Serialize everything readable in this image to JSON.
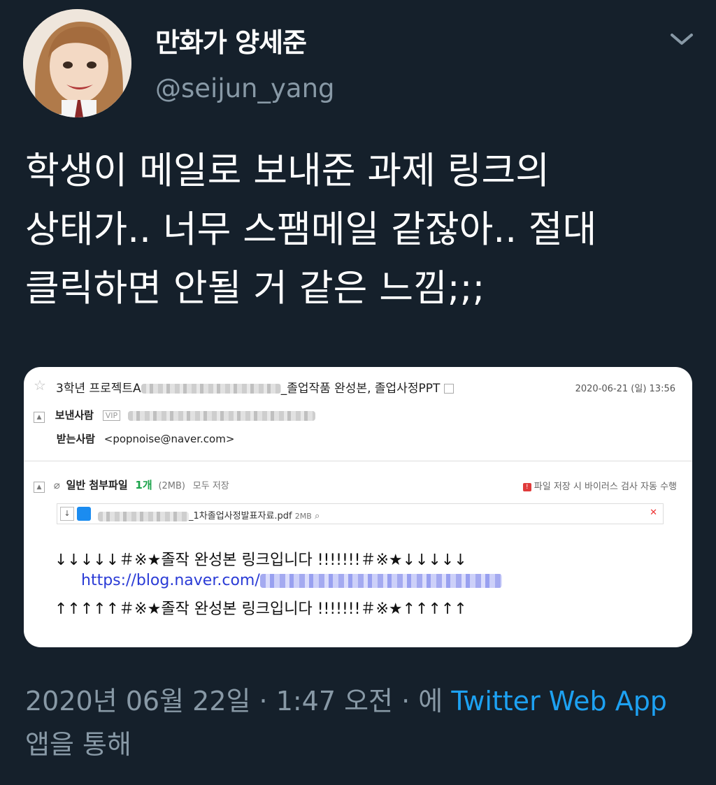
{
  "user": {
    "display_name": "만화가 양세준",
    "handle": "@seijun_yang"
  },
  "tweet": {
    "lines": [
      "학생이 메일로 보내준 과제 링크의",
      "상태가.. 너무 스팸메일 같잖아.. 절대",
      "클릭하면 안될 거 같은 느낌;;;"
    ]
  },
  "media": {
    "subject_prefix": "3학년 프로젝트A",
    "subject_suffix": "_졸업작품 완성본, 졸업사정PPT",
    "date": "2020-06-21 (일) 13:56",
    "sender_label": "보낸사람",
    "vip_badge": "VIP",
    "recipient_label": "받는사람",
    "recipient_value": "<popnoise@naver.com>",
    "attachment_label": "일반 첨부파일",
    "attachment_count": "1개",
    "attachment_size": "(2MB)",
    "save_all": "모두 저장",
    "virus_notice": "파일 저장 시 바이러스 검사 자동 수행",
    "file_name_suffix": "_1차졸업사정발표자료.pdf",
    "file_size": "2MB",
    "body_line_1": "↓↓↓↓↓＃※★졸작 완성본 링크입니다 !!!!!!!＃※★↓↓↓↓↓",
    "body_link_prefix": "https://blog.naver.com/",
    "body_line_2": "↑↑↑↑↑＃※★졸작 완성본 링크입니다 !!!!!!!＃※★↑↑↑↑↑"
  },
  "footer": {
    "timestamp": "2020년 06월 22일 · 1:47 오전 · 에",
    "app_name": "Twitter Web App",
    "via_suffix": "앱을 통해"
  },
  "colors": {
    "background": "#15202b",
    "secondary_text": "#8899a6",
    "link": "#1da1f2"
  }
}
